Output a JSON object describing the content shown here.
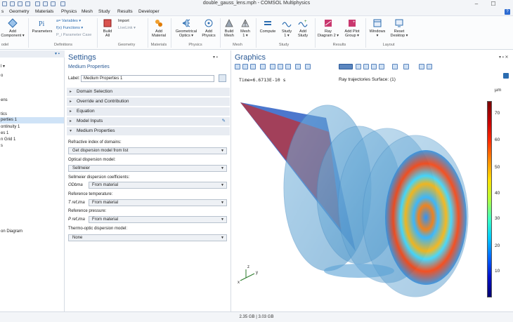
{
  "window": {
    "title": "double_gauss_lens.mph - COMSOL Multiphysics",
    "minimize": "–",
    "maximize": "☐",
    "help": "?"
  },
  "menu": [
    "s",
    "Geometry",
    "Materials",
    "Physics",
    "Mesh",
    "Study",
    "Results",
    "Developer"
  ],
  "ribbon": {
    "add_component": "Add",
    "add_component_2": "Component ▾",
    "parameters": "Parameters",
    "variables": "a= Variables ▾",
    "functions": "f(x) Functions ▾",
    "parameter_case": "P_i Parameter Case",
    "build_all": "Build",
    "build_all_2": "All",
    "import": "Import",
    "livelink": "LiveLink ▾",
    "add_material": "Add",
    "add_material_2": "Material",
    "geometrical_optics": "Geometrical",
    "geometrical_optics_2": "Optics ▾",
    "add_physics": "Add",
    "add_physics_2": "Physics",
    "build_mesh": "Build",
    "build_mesh_2": "Mesh",
    "mesh1": "Mesh",
    "mesh1_2": "1 ▾",
    "compute": "Compute",
    "study1": "Study",
    "study1_2": "1 ▾",
    "add_study": "Add",
    "add_study_2": "Study",
    "ray_diagram": "Ray",
    "ray_diagram_2": "Diagram 2 ▾",
    "add_plot_group": "Add Plot",
    "add_plot_group_2": "Group ▾",
    "windows": "Windows",
    "windows_2": "▾",
    "reset_desktop": "Reset",
    "reset_desktop_2": "Desktop ▾",
    "groups": {
      "model": "odel",
      "definitions": "Definitions",
      "geometry": "Geometry",
      "materials": "Materials",
      "physics": "Physics",
      "mesh": "Mesh",
      "study": "Study",
      "results": "Results",
      "layout": "Layout"
    }
  },
  "tree": {
    "items": [
      "l ▾",
      "o",
      "ens",
      "tics",
      "perties 1",
      "ontinuity 1",
      "es 1",
      "n Grid 1",
      "s",
      "on Diagram"
    ],
    "selected_index": 4
  },
  "settings": {
    "title": "Settings",
    "subtitle": "Medium Properties",
    "label_caption": "Label:",
    "label_value": "Medium Properties 1",
    "sections": [
      "Domain Selection",
      "Override and Contribution",
      "Equation",
      "Model Inputs",
      "Medium Properties"
    ],
    "refractive_label": "Refractive index of domains:",
    "refractive_value": "Get dispersion model from list",
    "optical_label": "Optical dispersion model:",
    "optical_value": "Sellmeier",
    "sellmeier_label": "Sellmeier dispersion coefficients:",
    "sellmeier_sym": "ODbma",
    "sellmeier_value": "From material",
    "reftemp_label": "Reference temperature:",
    "reftemp_sym": "T ref,ima",
    "reftemp_value": "From material",
    "refpress_label": "Reference pressure:",
    "refpress_sym": "P ref,ima",
    "refpress_value": "From material",
    "thermo_label": "Thermo-optic dispersion model:",
    "thermo_value": "None"
  },
  "graphics": {
    "title": "Graphics",
    "time": "Time=6.6713E-10 s",
    "caption": "Ray trajectories  Surface: (1)",
    "unit": "µm",
    "ticks": [
      "70",
      "60",
      "50",
      "40",
      "30",
      "20",
      "10"
    ],
    "axis_x": "x",
    "axis_y": "y",
    "axis_z": "z"
  },
  "status": "2.35 GB | 3.03 GB"
}
